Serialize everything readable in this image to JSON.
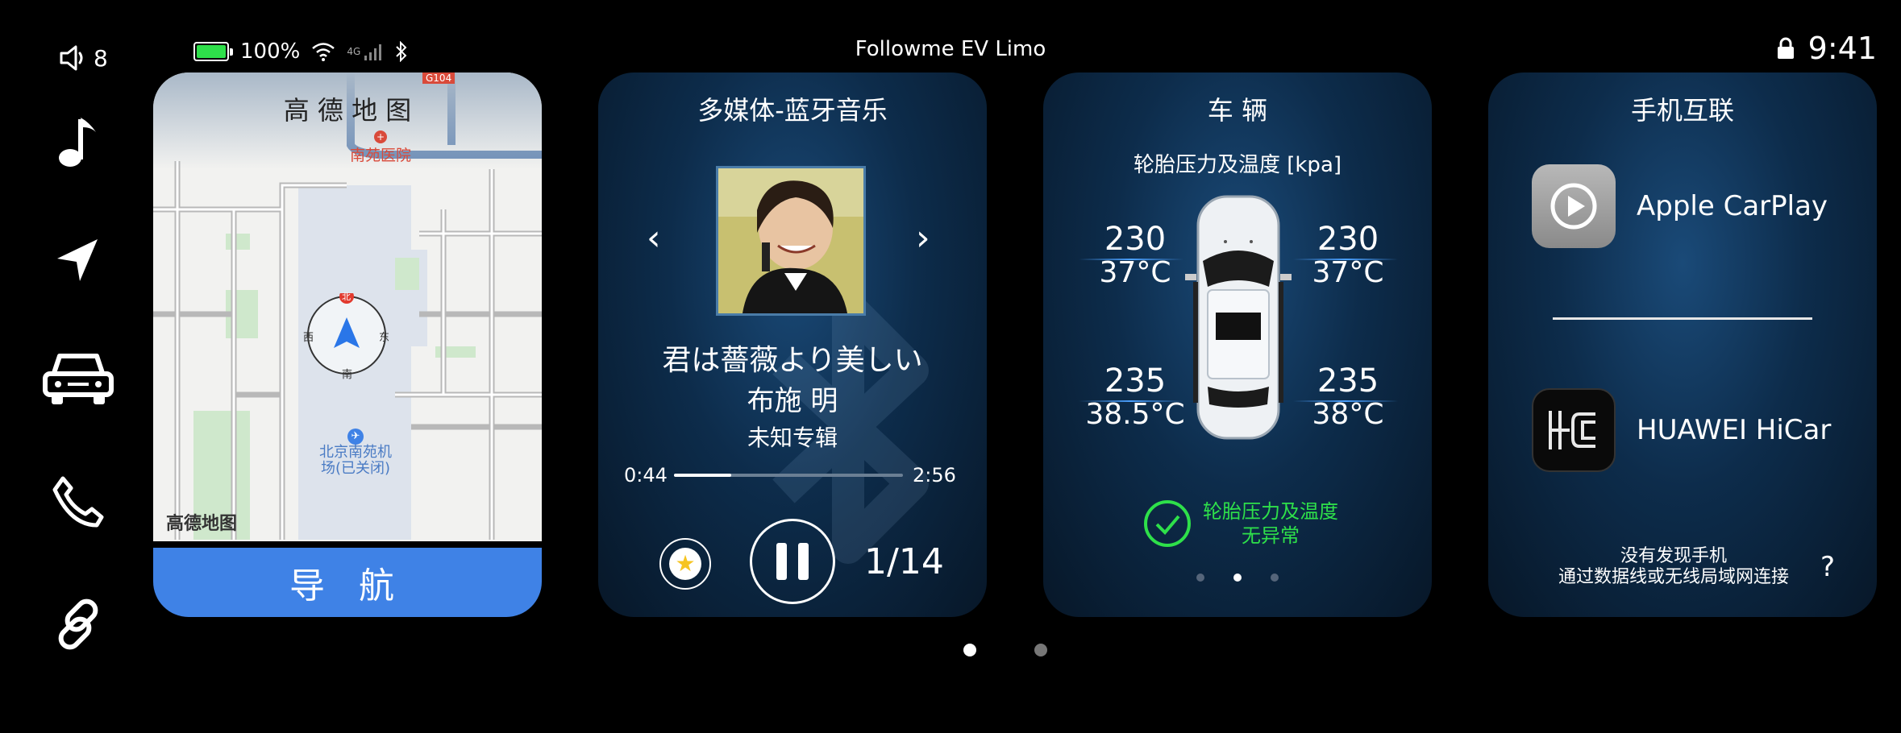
{
  "status_bar": {
    "volume_level": "8",
    "battery_percent": "100%",
    "signal_label": "4G",
    "title": "Followme EV Limo",
    "time": "9:41"
  },
  "sidebar": {
    "items": [
      {
        "name": "music"
      },
      {
        "name": "navigation"
      },
      {
        "name": "vehicle"
      },
      {
        "name": "phone"
      },
      {
        "name": "link"
      }
    ]
  },
  "map_card": {
    "title": "高 德 地 图",
    "road_label": "G104",
    "poi_hospital": "南苑医院",
    "poi_airport_line1": "北京南苑机",
    "poi_airport_line2": "场(已关闭)",
    "compass_n": "北",
    "compass_e": "东",
    "compass_w": "西",
    "compass_s": "南",
    "logo": "高德地图",
    "nav_button": "导 航"
  },
  "music_card": {
    "title": "多媒体-蓝牙音乐",
    "song_title": "君は薔薇より美しい",
    "artist": "布施 明",
    "album": "未知专辑",
    "elapsed": "0:44",
    "duration": "2:56",
    "progress": 0.25,
    "track_position": "1/14"
  },
  "vehicle_card": {
    "title": "车 辆",
    "subtitle": "轮胎压力及温度 [kpa]",
    "tires": {
      "front_left": {
        "pressure": "230",
        "temp": "37°C"
      },
      "front_right": {
        "pressure": "230",
        "temp": "37°C"
      },
      "rear_left": {
        "pressure": "235",
        "temp": "38.5°C"
      },
      "rear_right": {
        "pressure": "235",
        "temp": "38°C"
      }
    },
    "status_line1": "轮胎压力及温度",
    "status_line2": "无异常",
    "status_color": "#2ee04a",
    "page_dots": 3,
    "active_dot": 2
  },
  "phone_card": {
    "title": "手机互联",
    "carplay_label": "Apple CarPlay",
    "hicar_label": "HUAWEI HiCar",
    "status_line1": "没有发现手机",
    "status_line2": "通过数据线或无线局域网连接",
    "help": "?"
  },
  "pagination": {
    "pages": 2,
    "active": 1
  },
  "colors": {
    "accent_blue": "#3f82e6",
    "ok_green": "#2ee04a",
    "card_bg": "#0d2c4b"
  }
}
